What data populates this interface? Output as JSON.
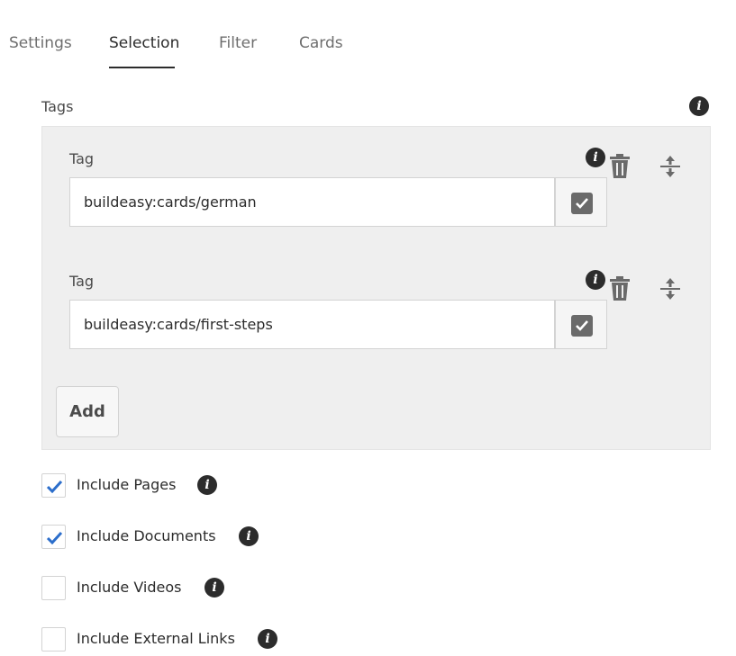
{
  "tabs": [
    {
      "label": "Settings",
      "active": false
    },
    {
      "label": "Selection",
      "active": true
    },
    {
      "label": "Filter",
      "active": false
    },
    {
      "label": "Cards",
      "active": false
    }
  ],
  "tags_field": {
    "label": "Tags",
    "items": [
      {
        "label": "Tag",
        "value": "buildeasy:cards/german"
      },
      {
        "label": "Tag",
        "value": "buildeasy:cards/first-steps"
      }
    ],
    "add_label": "Add"
  },
  "checkboxes": [
    {
      "label": "Include Pages",
      "checked": true
    },
    {
      "label": "Include Documents",
      "checked": true
    },
    {
      "label": "Include Videos",
      "checked": false
    },
    {
      "label": "Include External Links",
      "checked": false
    }
  ],
  "colors": {
    "check": "#2c6ecb",
    "text": "#2c2c2c",
    "panel": "#efefef"
  },
  "icons": {
    "info": "info-icon",
    "delete": "trash-icon",
    "reorder": "move-icon",
    "tag_picker": "checkbox-icon"
  }
}
